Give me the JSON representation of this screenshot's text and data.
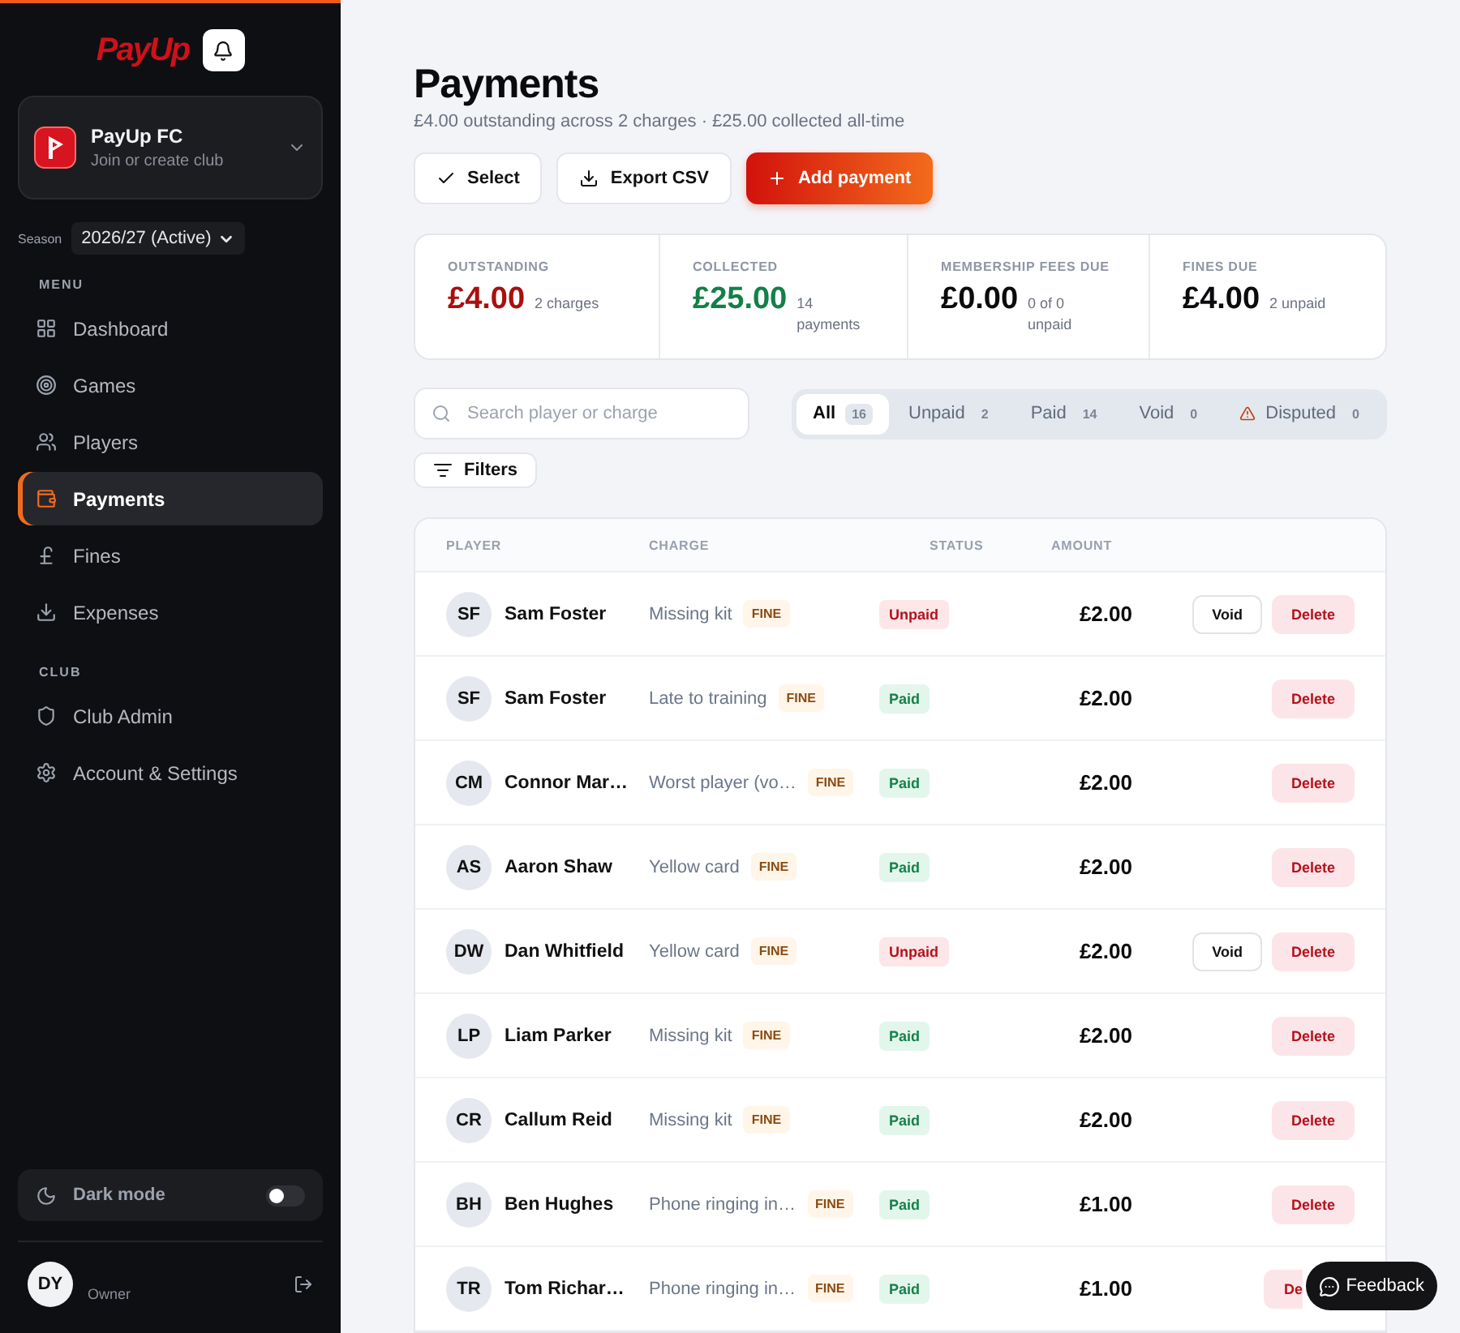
{
  "sidebar": {
    "logo": "PayUp",
    "club": {
      "name": "PayUp FC",
      "subtitle": "Join or create club"
    },
    "season": {
      "label": "Season",
      "value": "2026/27 (Active)"
    },
    "sections": [
      {
        "title": "MENU",
        "items": [
          {
            "label": "Dashboard",
            "selected": false
          },
          {
            "label": "Games",
            "selected": false
          },
          {
            "label": "Players",
            "selected": false
          },
          {
            "label": "Payments",
            "selected": true
          },
          {
            "label": "Fines",
            "selected": false
          },
          {
            "label": "Expenses",
            "selected": false
          }
        ]
      },
      {
        "title": "CLUB",
        "items": [
          {
            "label": "Club Admin",
            "selected": false
          },
          {
            "label": "Account & Settings",
            "selected": false
          }
        ]
      }
    ],
    "dark_mode": {
      "label": "Dark mode",
      "on": false
    },
    "user": {
      "initials": "DY",
      "role": "Owner"
    }
  },
  "page": {
    "title": "Payments",
    "subtitle": "£4.00 outstanding across 2 charges · £25.00 collected all-time",
    "actions": [
      {
        "label": "Select",
        "kind": "plain"
      },
      {
        "label": "Export CSV",
        "kind": "plain"
      },
      {
        "label": "Add payment",
        "kind": "primary"
      }
    ],
    "stats": [
      {
        "label": "OUTSTANDING",
        "value": "£4.00",
        "note": "2 charges",
        "color": "#a8100f"
      },
      {
        "label": "COLLECTED",
        "value": "£25.00",
        "note": "14 payments",
        "color": "#138047"
      },
      {
        "label": "MEMBERSHIP FEES DUE",
        "value": "£0.00",
        "note": "0 of 0 unpaid",
        "color": "#0b0b0d"
      },
      {
        "label": "FINES DUE",
        "value": "£4.00",
        "note": "2 unpaid",
        "color": "#0b0b0d"
      }
    ],
    "search": {
      "placeholder": "Search player or charge"
    },
    "tabs": [
      {
        "label": "All",
        "count": "16",
        "selected": true
      },
      {
        "label": "Unpaid",
        "count": "2",
        "selected": false
      },
      {
        "label": "Paid",
        "count": "14",
        "selected": false
      },
      {
        "label": "Void",
        "count": "0",
        "selected": false
      },
      {
        "label": "Disputed",
        "count": "0",
        "selected": false,
        "kind": "warning"
      }
    ],
    "filters": "Filters",
    "table": {
      "columns": [
        "PLAYER",
        "CHARGE",
        "STATUS",
        "AMOUNT"
      ],
      "rows": [
        {
          "initials": "SF",
          "player": "Sam Foster",
          "charge": "Missing kit",
          "tag": "FINE",
          "status": "Unpaid",
          "kind": "unpaid",
          "amount": "£2.00",
          "actions": [
            "Void",
            "Delete"
          ]
        },
        {
          "initials": "SF",
          "player": "Sam Foster",
          "charge": "Late to training",
          "tag": "FINE",
          "status": "Paid",
          "kind": "paid",
          "amount": "£2.00",
          "actions": [
            "Delete"
          ]
        },
        {
          "initials": "CM",
          "player": "Connor Mar…",
          "charge": "Worst player (vo…",
          "tag": "FINE",
          "status": "Paid",
          "kind": "paid",
          "amount": "£2.00",
          "actions": [
            "Delete"
          ]
        },
        {
          "initials": "AS",
          "player": "Aaron Shaw",
          "charge": "Yellow card",
          "tag": "FINE",
          "status": "Paid",
          "kind": "paid",
          "amount": "£2.00",
          "actions": [
            "Delete"
          ]
        },
        {
          "initials": "DW",
          "player": "Dan Whitfield",
          "charge": "Yellow card",
          "tag": "FINE",
          "status": "Unpaid",
          "kind": "unpaid",
          "amount": "£2.00",
          "actions": [
            "Void",
            "Delete"
          ]
        },
        {
          "initials": "LP",
          "player": "Liam Parker",
          "charge": "Missing kit",
          "tag": "FINE",
          "status": "Paid",
          "kind": "paid",
          "amount": "£2.00",
          "actions": [
            "Delete"
          ]
        },
        {
          "initials": "CR",
          "player": "Callum Reid",
          "charge": "Missing kit",
          "tag": "FINE",
          "status": "Paid",
          "kind": "paid",
          "amount": "£2.00",
          "actions": [
            "Delete"
          ]
        },
        {
          "initials": "BH",
          "player": "Ben Hughes",
          "charge": "Phone ringing in…",
          "tag": "FINE",
          "status": "Paid",
          "kind": "paid",
          "amount": "£1.00",
          "actions": [
            "Delete"
          ]
        },
        {
          "initials": "TR",
          "player": "Tom Richar…",
          "charge": "Phone ringing in…",
          "tag": "FINE",
          "status": "Paid",
          "kind": "paid",
          "amount": "£1.00",
          "actions": [
            "De"
          ]
        }
      ]
    }
  },
  "feedback": "Feedback"
}
